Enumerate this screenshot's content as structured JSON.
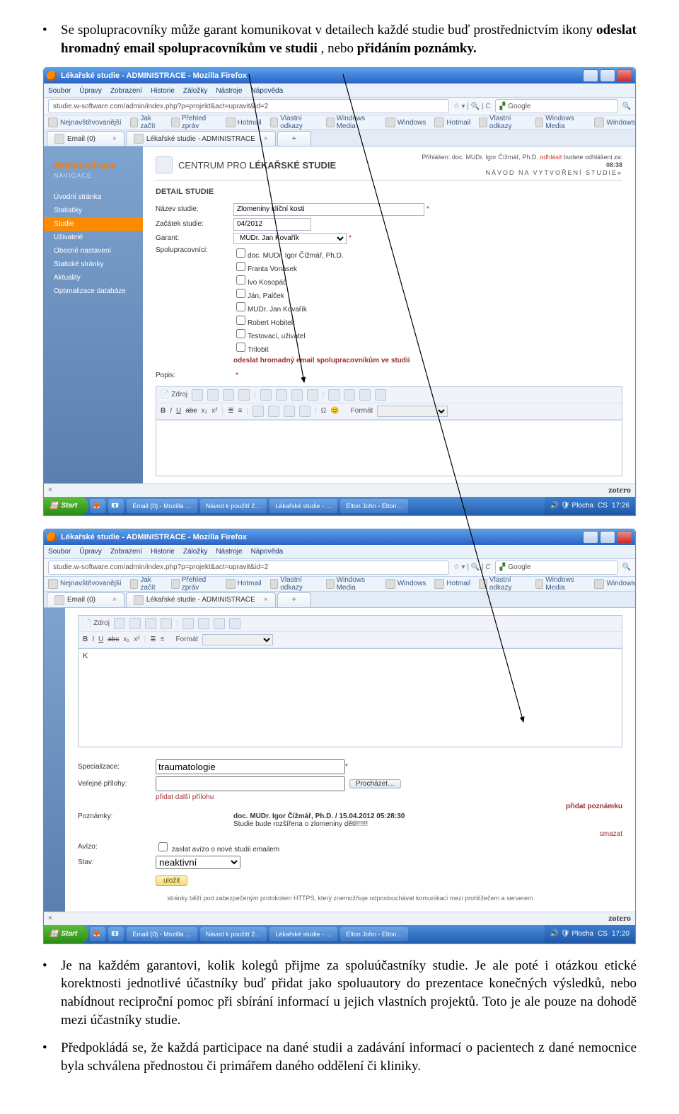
{
  "doc": {
    "para1_prefix": "Se spolupracovníky může garant komunikovat v detailech každé studie buď prostřednictvím ikony ",
    "para1_bold": "odeslat hromadný email spolupracovníkům ve studii",
    "para1_suffix": ", nebo ",
    "para1_bold2": "přidáním poznámky.",
    "para2": "Je na každém garantovi, kolik kolegů přijme za spoluúčastníky studie. Je ale poté i otázkou etické korektnosti jednotlivé účastníky buď přidat jako spoluautory do prezentace konečných výsledků, nebo nabídnout reciproční pomoc při sbírání informací u jejich vlastních projektů. Toto je ale pouze na dohodě mezi účastníky studie.",
    "para3": "Předpokládá se, že každá participace na dané studii a zadávání informací o pacientech z dané nemocnice byla schválena přednostou či primářem daného oddělení či kliniky."
  },
  "win": {
    "title": "Lékařské studie - ADMINISTRACE - Mozilla Firefox",
    "menu": [
      "Soubor",
      "Úpravy",
      "Zobrazení",
      "Historie",
      "Záložky",
      "Nástroje",
      "Nápověda"
    ],
    "addr1": "studie.w-software.com/admin/index.php?p=projekt&act=upravit&id=2",
    "search_ph": "Google",
    "bookmarks": [
      "Nejnavštěvovanější",
      "Jak začít",
      "Přehled zpráv",
      "Hotmail",
      "Vlastní odkazy",
      "Windows Media",
      "Windows",
      "Hotmail",
      "Vlastní odkazy",
      "Windows Media",
      "Windows"
    ],
    "tab1": "Email (0)",
    "tab2": "Lékařské studie - ADMINISTRACE",
    "tab_plus": "+"
  },
  "app": {
    "nav_title": "Administrace",
    "nav_sub": "NAVIGACE",
    "nav_items": [
      "Úvodní stránka",
      "Statistiky",
      "Studie",
      "Uživatelé",
      "Obecné nastavení",
      "Statické stránky",
      "Aktuality",
      "Optimalizace databáze"
    ],
    "centrum": "CENTRUM PRO LÉKAŘSKÉ STUDIE",
    "logged": "Přihlášen: doc. MUDr. Igor Čížmář, Ph.D.",
    "logout": "odhlásit",
    "logoff_note": "budete odhlášeni za:",
    "logoff_time": "08:38",
    "navod": "NÁVOD NA VYTVOŘENÍ STUDIE»",
    "section": "DETAIL STUDIE",
    "lbl_nazev": "Název studie:",
    "val_nazev": "Zlomeniny klíční kosti",
    "lbl_zacatek": "Začátek studie:",
    "val_zacatek": "04/2012",
    "lbl_garant": "Garant:",
    "val_garant": "MUDr. Jan Kovařík",
    "lbl_spol": "Spolupracovníci:",
    "spol_list": [
      "doc. MUDr. Igor Čížmář, Ph.D.",
      "Franta Vonásek",
      "Ivo Kosopáč",
      "Ján, Palček",
      "MUDr. Jan Kovařík",
      "Robert Hobitek",
      "Testovací, uživatel",
      "Trilobit"
    ],
    "mass_link": "odeslat hromadný email spolupracovníkům ve studii",
    "lbl_popis": "Popis:",
    "rt_row1": [
      "Zdroj",
      "formatting icons..."
    ],
    "rt_format": "Formát"
  },
  "app2": {
    "body_k": "K",
    "lbl_spec": "Specializace:",
    "val_spec": "traumatologie",
    "lbl_prilohy": "Veřejné přílohy:",
    "browse": "Procházet…",
    "add_att": "přidat další přílohu",
    "add_note": "přidat poznámku",
    "lbl_poznamky": "Poznámky:",
    "note_author": "doc. MUDr. Igor Čížmář, Ph.D. / 15.04.2012 05:28:30",
    "note_text": "Studie bude rozšířena o zlomeniny dětí!!!!!!",
    "delete_note": "smazat",
    "lbl_avizo": "Avízo:",
    "avizo_cb": "zaslat avízo o nové studii emailem",
    "lbl_stav": "Stav:",
    "stav_val": "neaktivní",
    "save": "uložit",
    "footer": "stránky běží pod zabezpečeným protokolem HTTPS, který znemožňuje odposlouchávat komunikaci mezi prohlížečem a serverem"
  },
  "taskbar": {
    "start": "Start",
    "items": [
      "Email (0) - Mozilla …",
      "Návod k použití 2…",
      "Lékařské studie - …",
      "Elton John - Elton…"
    ],
    "tray_time1": "17:26",
    "tray_time2": "17:20",
    "zotero": "zotero"
  }
}
